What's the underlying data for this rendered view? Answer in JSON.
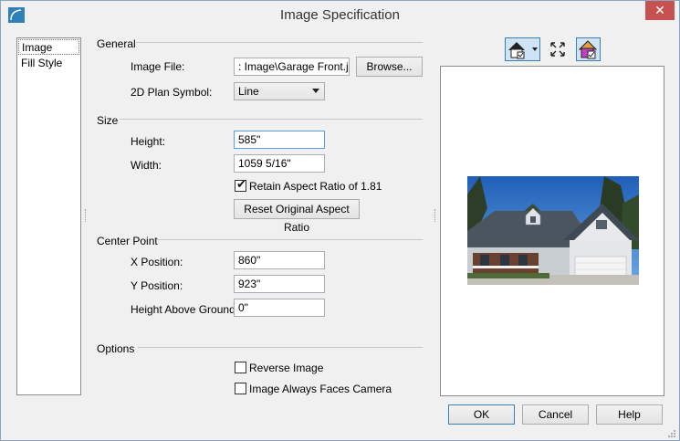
{
  "window": {
    "title": "Image Specification",
    "close_label": "✕"
  },
  "sidebar": {
    "items": [
      {
        "label": "Image"
      },
      {
        "label": "Fill Style"
      }
    ]
  },
  "general": {
    "section_label": "General",
    "image_file_label": "Image File:",
    "image_file_value": ": Image\\Garage Front.jpg",
    "browse_label": "Browse...",
    "plan_symbol_label": "2D Plan Symbol:",
    "plan_symbol_value": "Line"
  },
  "size": {
    "section_label": "Size",
    "height_label": "Height:",
    "height_value": "585\"",
    "width_label": "Width:",
    "width_value": "1059 5/16\"",
    "retain_label": "Retain Aspect Ratio of 1.81",
    "retain_checked": true,
    "reset_label": "Reset Original Aspect Ratio"
  },
  "center_point": {
    "section_label": "Center Point",
    "x_label": "X Position:",
    "x_value": "860\"",
    "y_label": "Y Position:",
    "y_value": "923\"",
    "h_label": "Height Above Ground:",
    "h_value": "0\""
  },
  "options": {
    "section_label": "Options",
    "reverse_label": "Reverse Image",
    "reverse_checked": false,
    "faces_camera_label": "Image Always Faces Camera",
    "faces_camera_checked": false
  },
  "preview_toolbar": {
    "icons": [
      "view-mode-icon",
      "fit-to-window-icon",
      "color-mode-icon"
    ]
  },
  "footer": {
    "ok_label": "OK",
    "cancel_label": "Cancel",
    "help_label": "Help"
  },
  "colors": {
    "close_bg": "#c75050",
    "focus_border": "#569de5",
    "default_btn_border": "#3c7fb1"
  }
}
